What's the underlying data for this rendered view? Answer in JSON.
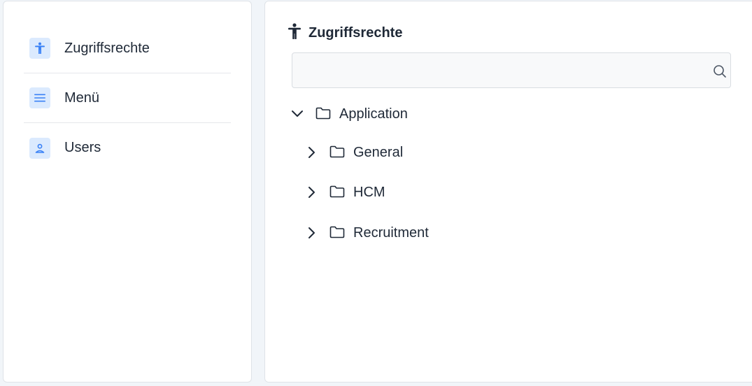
{
  "sidebar": {
    "items": [
      {
        "label": "Zugriffsrechte",
        "icon": "accessibility-icon"
      },
      {
        "label": "Menü",
        "icon": "menu-icon"
      },
      {
        "label": "Users",
        "icon": "user-icon"
      }
    ]
  },
  "main": {
    "title": "Zugriffsrechte",
    "search": {
      "value": "",
      "placeholder": ""
    },
    "tree": {
      "root": {
        "label": "Application",
        "expanded": true
      },
      "children": [
        {
          "label": "General",
          "expanded": false
        },
        {
          "label": "HCM",
          "expanded": false
        },
        {
          "label": "Recruitment",
          "expanded": false
        }
      ]
    }
  },
  "colors": {
    "accent": "#3b82f6",
    "icon_bg": "#dbeafe",
    "text": "#1f2937",
    "background": "#f1f5f9"
  }
}
